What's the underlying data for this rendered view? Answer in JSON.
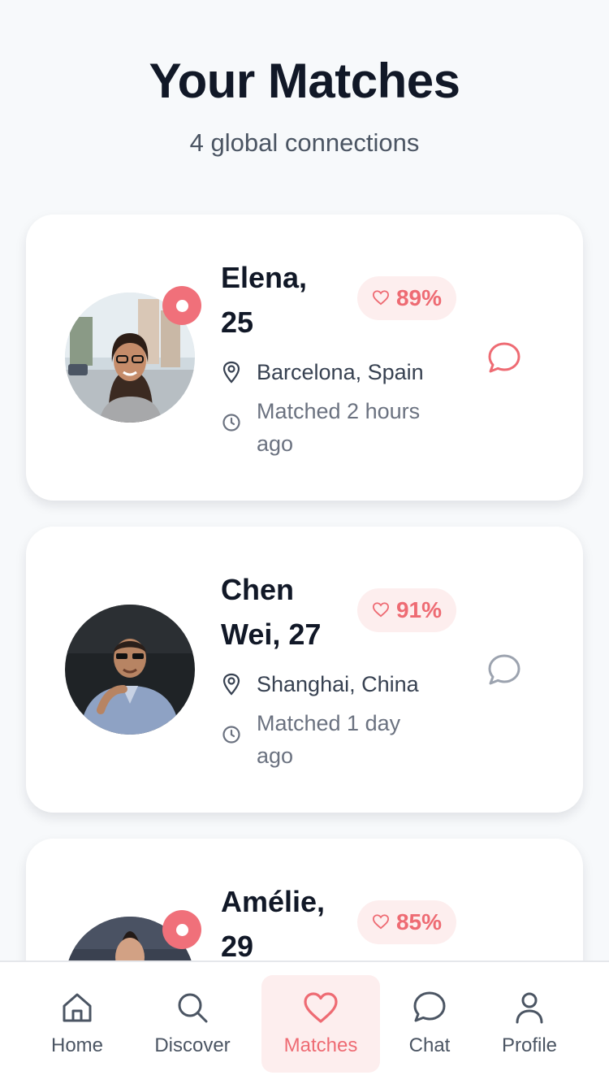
{
  "header": {
    "title": "Your Matches",
    "subtitle": "4 global connections"
  },
  "matches": [
    {
      "name": "Elena, 25",
      "score": "89%",
      "location": "Barcelona, Spain",
      "matched": "Matched 2 hours ago",
      "online": true,
      "chat_icon": "chat-bubble-icon",
      "chat_color": "#ee6b73"
    },
    {
      "name": "Chen Wei, 27",
      "score": "91%",
      "location": "Shanghai, China",
      "matched": "Matched 1 day ago",
      "online": false,
      "chat_icon": "chat-bubble-icon",
      "chat_color": "#9ca3af"
    },
    {
      "name": "Amélie, 29",
      "score": "85%",
      "online": true
    }
  ],
  "tabs": [
    {
      "label": "Home",
      "icon": "home-icon",
      "active": false
    },
    {
      "label": "Discover",
      "icon": "search-icon",
      "active": false
    },
    {
      "label": "Matches",
      "icon": "heart-icon",
      "active": true
    },
    {
      "label": "Chat",
      "icon": "chat-icon",
      "active": false
    },
    {
      "label": "Profile",
      "icon": "user-icon",
      "active": false
    }
  ],
  "colors": {
    "accent": "#ee6b73",
    "accent_soft": "#fdeeee",
    "background": "#f7f9fb",
    "text_primary": "#111827",
    "text_secondary": "#6b7280"
  }
}
